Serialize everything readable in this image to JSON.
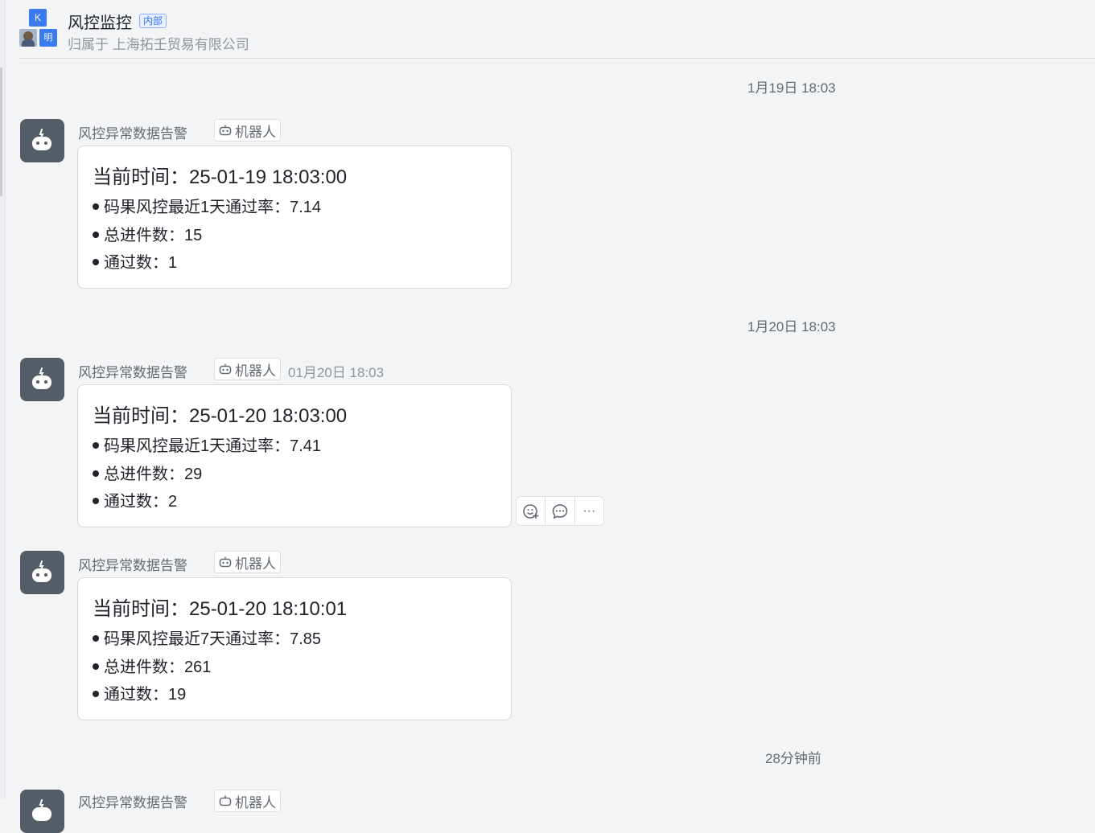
{
  "header": {
    "avatar_k": "K",
    "avatar_ming": "明",
    "title": "风控监控",
    "badge": "内部",
    "subtitle": "归属于 上海拓壬贸易有限公司"
  },
  "date_separators": [
    "1月19日 18:03",
    "1月20日 18:03",
    "28分钟前"
  ],
  "messages": [
    {
      "sender": "风控异常数据告警",
      "tag": "机器人",
      "time": "",
      "card": {
        "title": "当前时间：25-01-19 18:03:00",
        "lines": [
          "码果风控最近1天通过率：7.14",
          "总进件数：15",
          "通过数：1"
        ]
      }
    },
    {
      "sender": "风控异常数据告警",
      "tag": "机器人",
      "time": "01月20日 18:03",
      "card": {
        "title": "当前时间：25-01-20 18:03:00",
        "lines": [
          "码果风控最近1天通过率：7.41",
          "总进件数：29",
          "通过数：2"
        ]
      }
    },
    {
      "sender": "风控异常数据告警",
      "tag": "机器人",
      "time": "",
      "card": {
        "title": "当前时间：25-01-20 18:10:01",
        "lines": [
          "码果风控最近7天通过率：7.85",
          "总进件数：261",
          "通过数：19"
        ]
      }
    },
    {
      "sender": "风控异常数据告警",
      "tag": "机器人"
    }
  ],
  "message_actions": {
    "icons": [
      "emoji-reaction-icon",
      "reply-icon",
      "more-icon"
    ],
    "more_label": "···"
  }
}
